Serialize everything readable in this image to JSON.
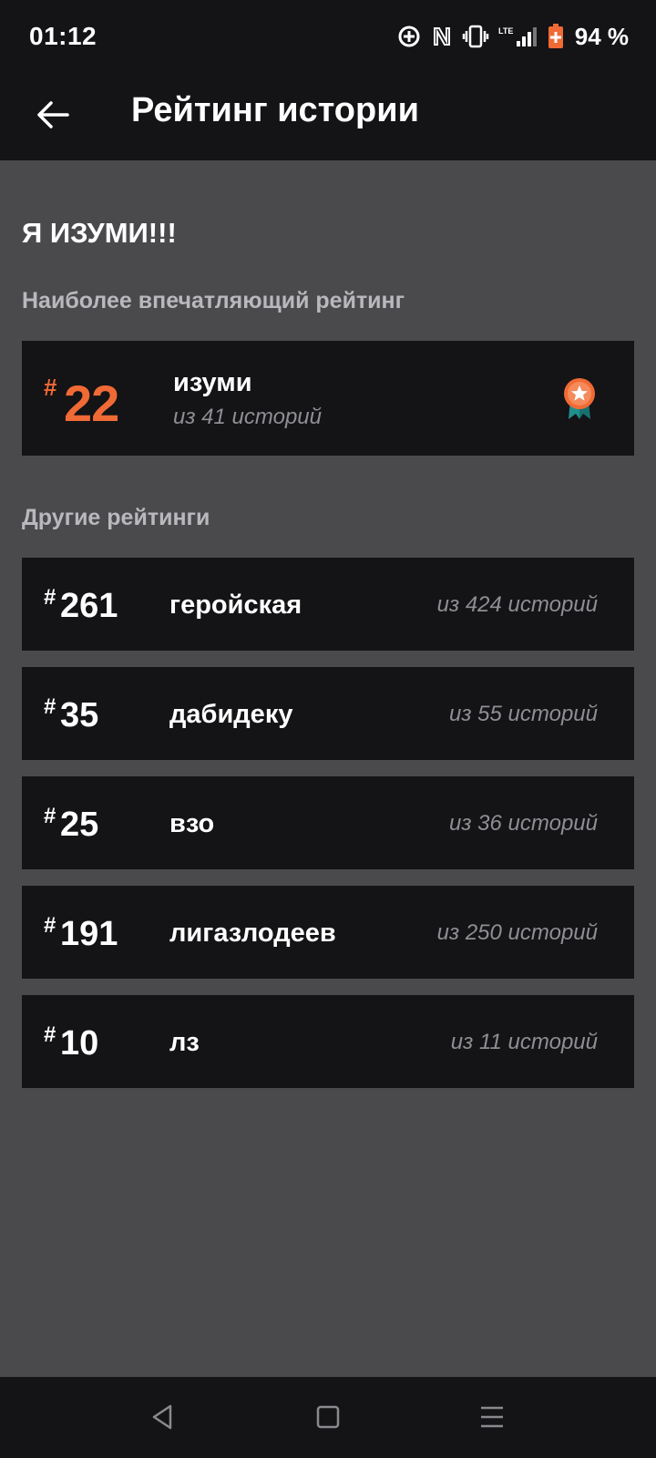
{
  "status": {
    "time": "01:12",
    "battery": "94 %",
    "icons": [
      "location-target-icon",
      "nfc-icon",
      "vibrate-icon",
      "lte-signal-icon",
      "battery-charging-icon"
    ]
  },
  "appbar": {
    "title": "Рейтинг истории",
    "back_icon": "arrow-left-icon"
  },
  "story": {
    "title": "Я ИЗУМИ!!!"
  },
  "featured": {
    "section_label": "Наиболее впечатляющий рейтинг",
    "hash": "#",
    "rank": "22",
    "tag": "изуми",
    "count": "из 41 историй",
    "badge_icon": "star-medal-icon",
    "accent_color": "#f06a35"
  },
  "others": {
    "section_label": "Другие рейтинги",
    "items": [
      {
        "hash": "#",
        "rank": "261",
        "tag": "геройская",
        "count": "из 424 историй"
      },
      {
        "hash": "#",
        "rank": "35",
        "tag": "дабидеку",
        "count": "из 55 историй"
      },
      {
        "hash": "#",
        "rank": "25",
        "tag": "взо",
        "count": "из 36 историй"
      },
      {
        "hash": "#",
        "rank": "191",
        "tag": "лигазлодеев",
        "count": "из 250 историй"
      },
      {
        "hash": "#",
        "rank": "10",
        "tag": "лз",
        "count": "из 11 историй"
      }
    ]
  },
  "navbar": {
    "icons": [
      "back-triangle-icon",
      "home-square-icon",
      "menu-lines-icon"
    ]
  }
}
